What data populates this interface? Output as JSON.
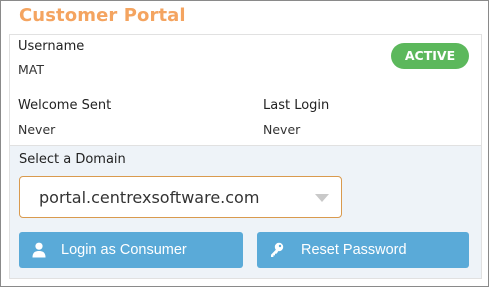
{
  "portal": {
    "title": "Customer Portal",
    "status_badge": "ACTIVE",
    "username_label": "Username",
    "username_value": "MAT",
    "welcome_label": "Welcome Sent",
    "welcome_value": "Never",
    "last_login_label": "Last Login",
    "last_login_value": "Never"
  },
  "domain": {
    "label": "Select a Domain",
    "selected": "portal.centrexsoftware.com"
  },
  "actions": {
    "login_label": "Login as Consumer",
    "login_icon": "user-icon",
    "reset_label": "Reset Password",
    "reset_icon": "key-icon"
  },
  "colors": {
    "title": "#f4a460",
    "badge": "#5cb85c",
    "button": "#5aaad8",
    "select_border": "#d99a4e"
  }
}
